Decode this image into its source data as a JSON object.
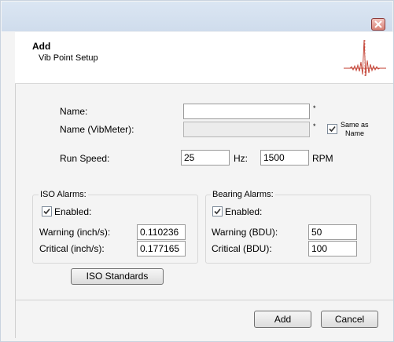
{
  "dialog": {
    "title": "Add",
    "subtitle": "Vib Point Setup"
  },
  "form": {
    "name_label": "Name:",
    "name_value": "",
    "name_required": "*",
    "vibmeter_label": "Name (VibMeter):",
    "vibmeter_value": "",
    "vibmeter_required": "*",
    "same_as_name_line1": "Same as",
    "same_as_name_line2": "Name",
    "same_as_name_checked": true,
    "run_speed_label": "Run Speed:",
    "run_speed_hz": "25",
    "hz_unit": "Hz:",
    "run_speed_rpm": "1500",
    "rpm_unit": "RPM"
  },
  "iso_alarms": {
    "title": "ISO Alarms:",
    "enabled_label": "Enabled:",
    "enabled_checked": true,
    "warning_label": "Warning (inch/s):",
    "warning_value": "0.110236",
    "critical_label": "Critical (inch/s):",
    "critical_value": "0.177165",
    "standards_button": "ISO Standards"
  },
  "bearing_alarms": {
    "title": "Bearing Alarms:",
    "enabled_label": "Enabled:",
    "enabled_checked": true,
    "warning_label": "Warning (BDU):",
    "warning_value": "50",
    "critical_label": "Critical (BDU):",
    "critical_value": "100"
  },
  "footer": {
    "add_button": "Add",
    "cancel_button": "Cancel"
  },
  "icons": {
    "close": "close-icon",
    "waveform": "waveform-icon",
    "checkmark": "checkmark-icon"
  },
  "colors": {
    "titlebar": "#d5e1f0",
    "close_button": "#d88276",
    "waveform": "#c0392b"
  }
}
